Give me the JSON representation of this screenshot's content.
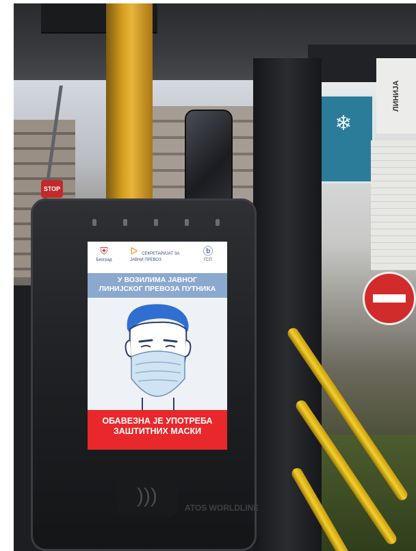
{
  "scene": {
    "stop_sign_text": "STOP",
    "window_paper_text": "ЛИНИЈА"
  },
  "validator_screen": {
    "logo_left": "Београд",
    "logo_center": "СЕКРЕТАРИЈАТ ЗА ЈАВНИ ПРЕВОЗ",
    "logo_right": "ГСП",
    "headline_line1": "У ВОЗИЛИМА ЈАВНОГ",
    "headline_line2": "ЛИНИЈСКОГ ПРЕВОЗА ПУТНИКА",
    "warning_line1": "ОБАВЕЗНА ЈЕ УПОТРЕБА",
    "warning_line2": "ЗАШТИТНИХ МАСКИ",
    "colors": {
      "headline_band": "#8ba9cf",
      "warning_band": "#e8282b",
      "mask": "#cfe3f3",
      "hair": "#2f6fd0"
    }
  },
  "validator_device": {
    "brand": "ATOS WORLDLINE",
    "contactless_icon": "contactless-icon"
  }
}
